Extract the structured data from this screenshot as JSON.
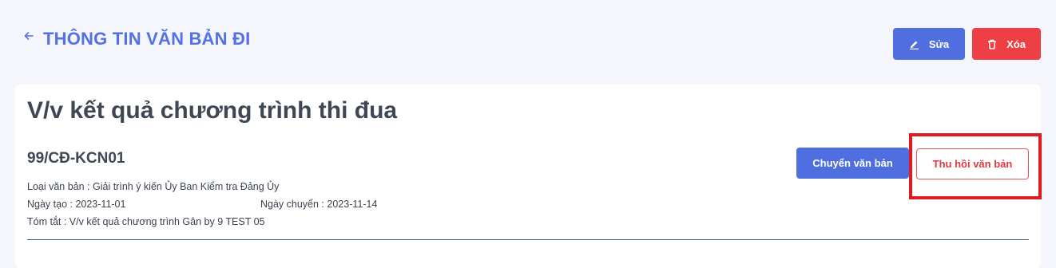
{
  "header": {
    "title": "THÔNG TIN VĂN BẢN ĐI",
    "edit_label": "Sửa",
    "delete_label": "Xóa"
  },
  "document": {
    "title": "V/v kết quả chương trình thi đua",
    "number": "99/CĐ-KCN01",
    "type_text": "Loại văn bản : Giải trình ý kiến Ủy Ban Kiểm tra Đảng Ủy",
    "created_text": "Ngày tạo : 2023-11-01",
    "sent_text": "Ngày chuyển : 2023-11-14",
    "summary_text": "Tóm tắt : V/v kết quả chương trình Gân by 9 TEST 05"
  },
  "actions": {
    "transfer_label": "Chuyển văn bản",
    "revoke_label": "Thu hồi văn bản"
  },
  "colors": {
    "primary": "#4f6fe0",
    "danger": "#ee3f45",
    "highlight": "#e01a22"
  }
}
